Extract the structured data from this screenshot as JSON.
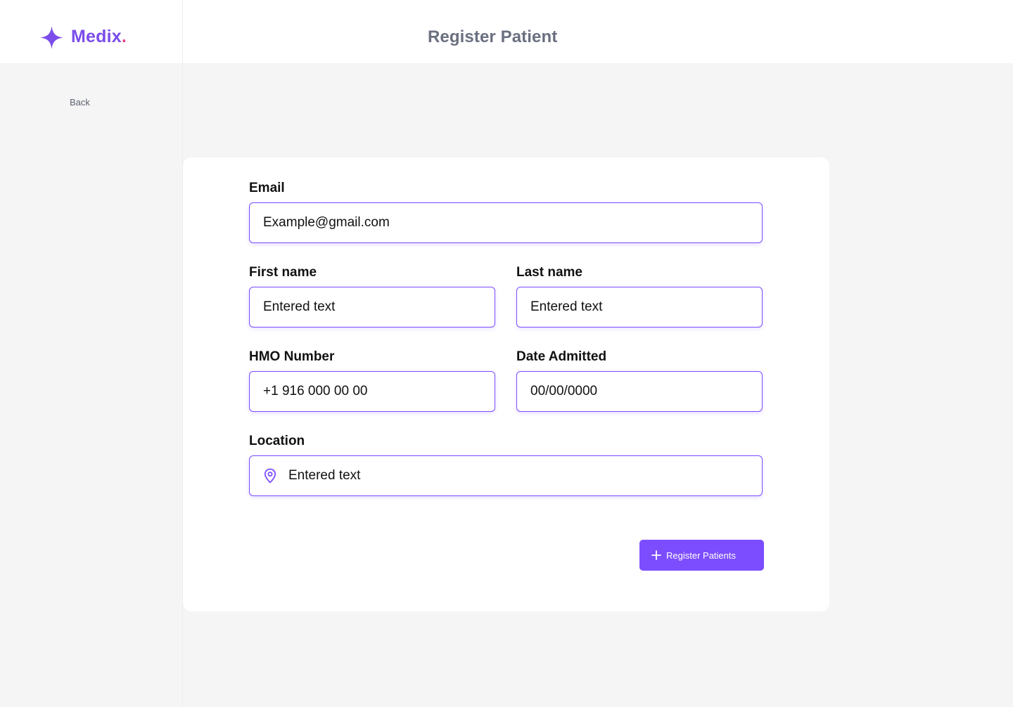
{
  "app": {
    "brand": "Medix",
    "brand_dot": ".",
    "page_title": "Register Patient",
    "brand_color": "#7b4dea",
    "accent_color": "#7c4dff"
  },
  "sidebar": {
    "back_label": "Back"
  },
  "form": {
    "email": {
      "label": "Email",
      "value": "Example@gmail.com"
    },
    "first_name": {
      "label": "First name",
      "value": "Entered text"
    },
    "last_name": {
      "label": "Last name",
      "value": "Entered text"
    },
    "hmo_number": {
      "label": "HMO Number",
      "value": "+1 916 000 00 00"
    },
    "date_admitted": {
      "label": "Date Admitted",
      "value": "00/00/0000"
    },
    "location": {
      "label": "Location",
      "value": "Entered text",
      "icon": "location-pin-icon"
    }
  },
  "actions": {
    "register_label": "Register Patients",
    "register_icon": "plus-icon"
  }
}
